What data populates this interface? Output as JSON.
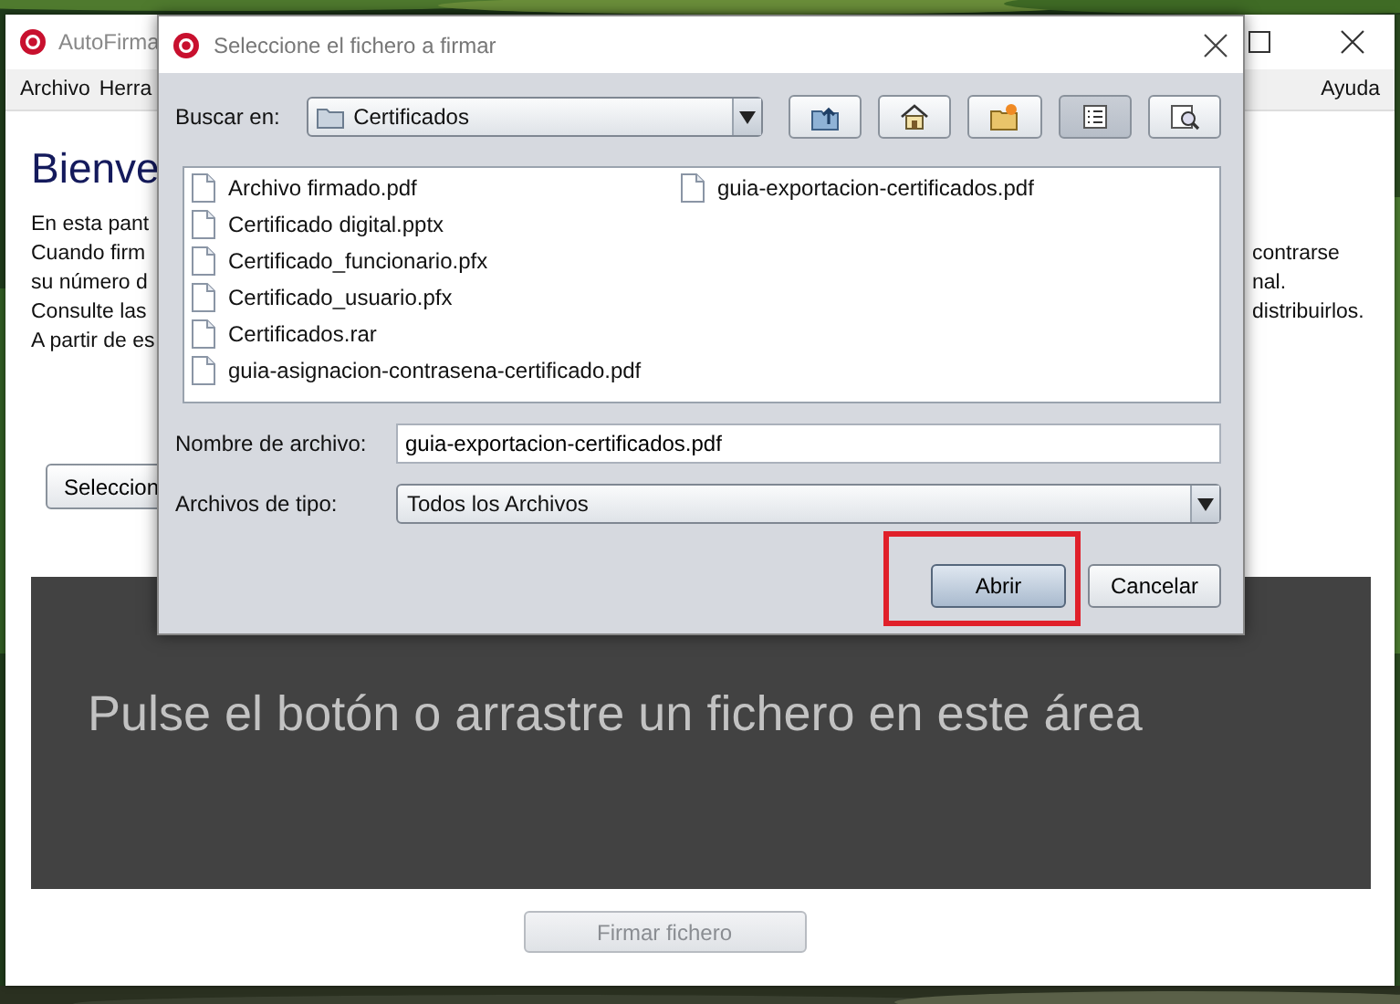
{
  "main_window": {
    "title": "AutoFirma",
    "menu": [
      {
        "label": "Archivo"
      },
      {
        "label": "Herra"
      }
    ],
    "menu_right": [
      {
        "label": "Ayuda"
      }
    ],
    "heading": "Bienve",
    "intro": [
      {
        "left": "En esta pant"
      },
      {
        "left": "Cuando firm",
        "right": "contrarse"
      },
      {
        "left": "su número d",
        "right": "nal."
      },
      {
        "left": "Consulte las",
        "right": "distribuirlos."
      },
      {
        "left": "A partir de es"
      }
    ],
    "select_button": "Seleccion",
    "drop_area": "Pulse el botón o arrastre un fichero en este área",
    "sign_button": {
      "label": "Firmar fichero",
      "disabled": true
    }
  },
  "dialog": {
    "title": "Seleccione el fichero a firmar",
    "look_in": {
      "label": "Buscar en:",
      "value": "Certificados"
    },
    "toolbar": [
      {
        "kind": "up",
        "selected": false
      },
      {
        "kind": "home",
        "selected": false
      },
      {
        "kind": "new-folder",
        "selected": false
      },
      {
        "kind": "list",
        "selected": true
      },
      {
        "kind": "details",
        "selected": false
      }
    ],
    "files": [
      {
        "name": "Archivo firmado.pdf"
      },
      {
        "name": "Certificado digital.pptx"
      },
      {
        "name": "Certificado_funcionario.pfx"
      },
      {
        "name": "Certificado_usuario.pfx"
      },
      {
        "name": "Certificados.rar"
      },
      {
        "name": "guia-asignacion-contrasena-certificado.pdf"
      },
      {
        "name": "guia-exportacion-certificados.pdf"
      }
    ],
    "file_name": {
      "label": "Nombre de archivo:",
      "value": "guia-exportacion-certificados.pdf"
    },
    "file_type": {
      "label": "Archivos de tipo:",
      "value": "Todos los Archivos"
    },
    "buttons": [
      {
        "label": "Abrir",
        "default": true,
        "highlighted": true
      },
      {
        "label": "Cancelar",
        "default": false,
        "highlighted": false
      }
    ]
  }
}
